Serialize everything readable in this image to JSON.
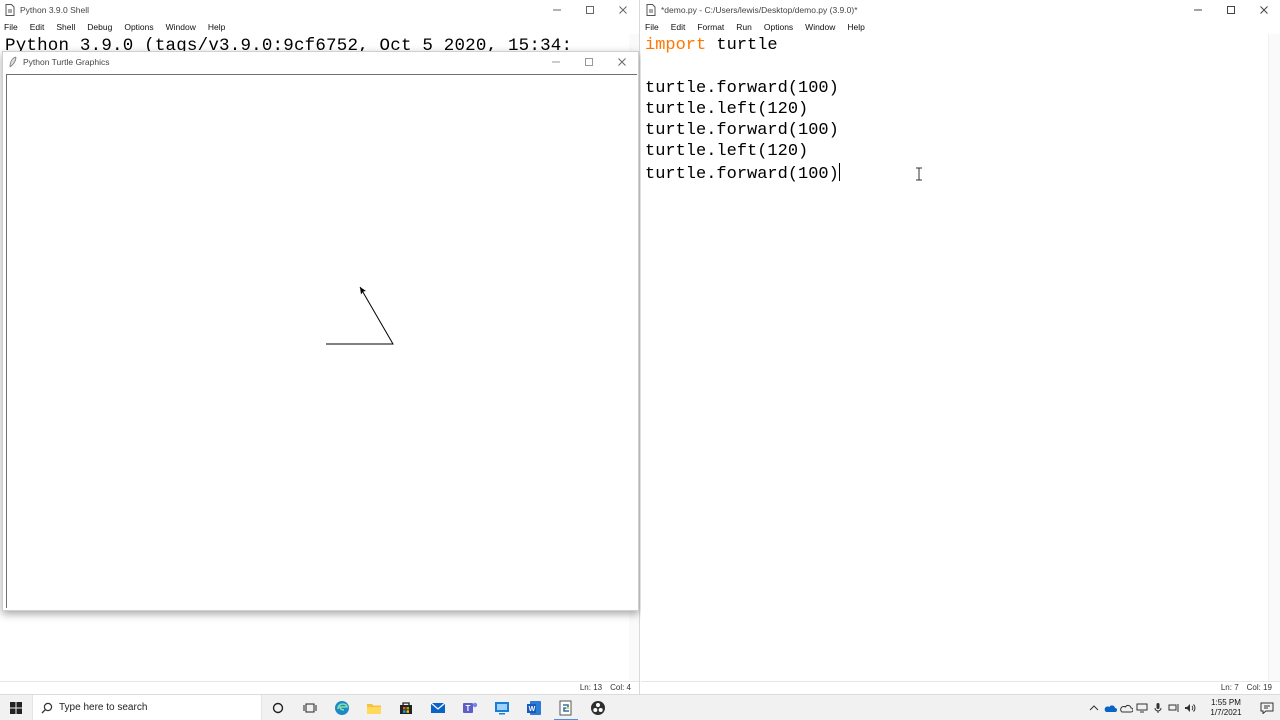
{
  "shell": {
    "title": "Python 3.9.0 Shell",
    "menu": [
      "File",
      "Edit",
      "Shell",
      "Debug",
      "Options",
      "Window",
      "Help"
    ],
    "banner": "Python 3.9.0 (tags/v3.9.0:9cf6752, Oct  5 2020, 15:34:",
    "status": {
      "ln": "Ln: 13",
      "col": "Col: 4"
    }
  },
  "turtle_window": {
    "title": "Python Turtle Graphics"
  },
  "editor": {
    "title": "*demo.py - C:/Users/lewis/Desktop/demo.py (3.9.0)*",
    "menu": [
      "File",
      "Edit",
      "Format",
      "Run",
      "Options",
      "Window",
      "Help"
    ],
    "code": {
      "line1_kw": "import",
      "line1_rest": " turtle",
      "line3": "turtle.forward(100)",
      "line4": "turtle.left(120)",
      "line5": "turtle.forward(100)",
      "line6": "turtle.left(120)",
      "line7": "turtle.forward(100)"
    },
    "status": {
      "ln": "Ln: 7",
      "col": "Col: 19"
    }
  },
  "taskbar": {
    "search_placeholder": "Type here to search",
    "time": "1:55 PM",
    "date": "1/7/2021"
  },
  "colors": {
    "keyword": "#ff7700",
    "taskbar_bg": "#f1f1f1",
    "active_indicator": "#4a90e2"
  }
}
